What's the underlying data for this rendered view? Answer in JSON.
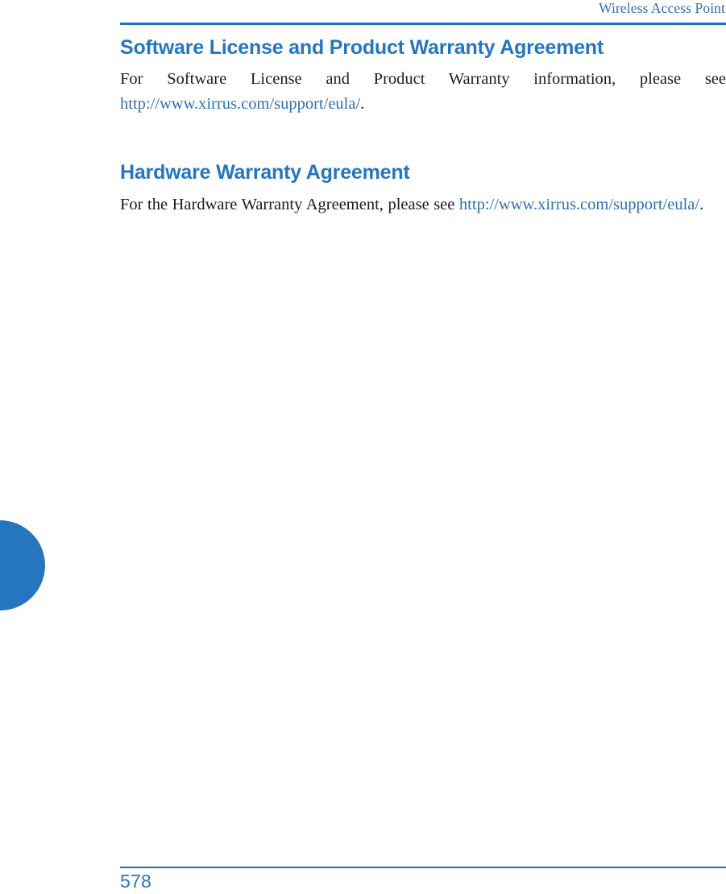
{
  "document": {
    "running_header": "Wireless Access Point",
    "page_number": "578"
  },
  "colors": {
    "heading_blue": "#2576be",
    "rule_blue": "#1f6fb5",
    "link_blue": "#2f6fb0",
    "body_text": "#1b1b1b",
    "tab_blue": "#2576be"
  },
  "sections": [
    {
      "heading": "Software License and Product Warranty Agreement",
      "paragraph_lead": "For Software License and Product Warranty information, please see ",
      "paragraph_link": "http://www.xirrus.com/support/eula/",
      "paragraph_tail": "."
    },
    {
      "heading": "Hardware Warranty Agreement",
      "paragraph_lead": "For the Hardware Warranty Agreement, please see ",
      "paragraph_link": "http://www.xirrus.com/support/eula/",
      "paragraph_tail": "."
    }
  ]
}
